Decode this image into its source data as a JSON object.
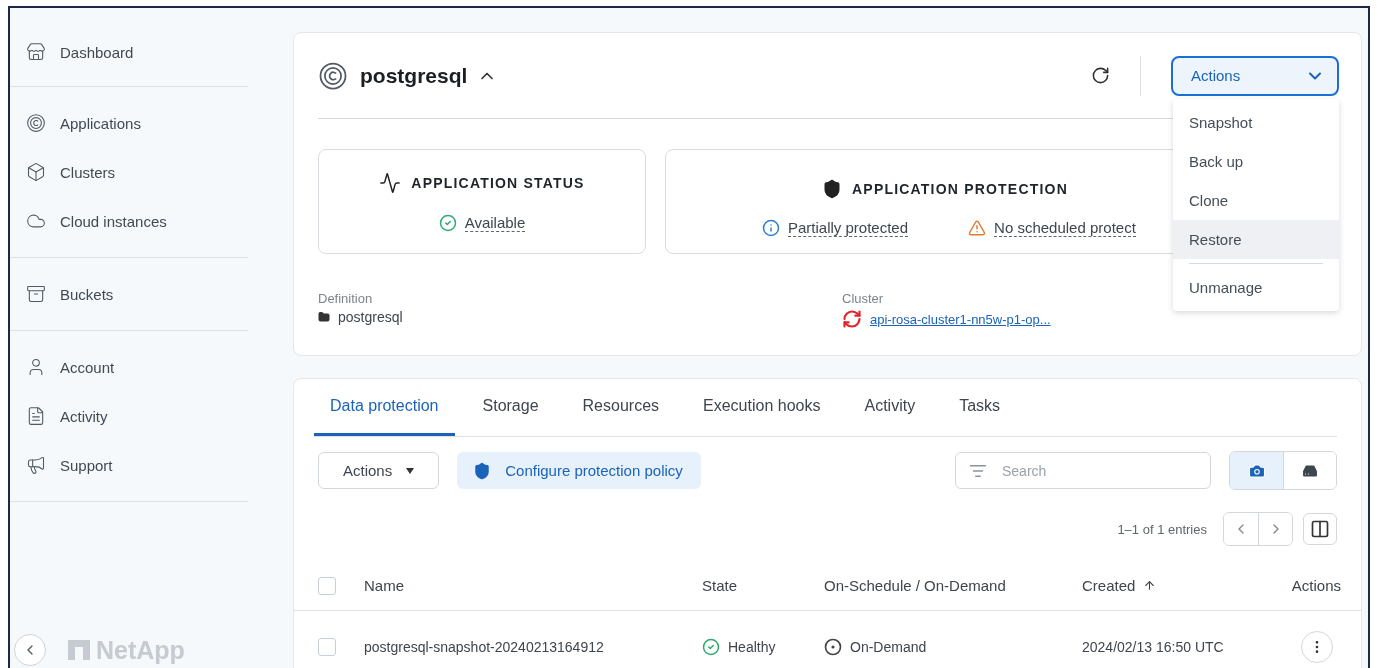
{
  "sidebar": {
    "groups": [
      [
        {
          "label": "Dashboard"
        }
      ],
      [
        {
          "label": "Applications"
        },
        {
          "label": "Clusters"
        },
        {
          "label": "Cloud instances"
        }
      ],
      [
        {
          "label": "Buckets"
        }
      ],
      [
        {
          "label": "Account"
        },
        {
          "label": "Activity"
        },
        {
          "label": "Support"
        }
      ]
    ],
    "brand": "NetApp"
  },
  "app": {
    "name": "postgresql",
    "expanded": true,
    "actions": {
      "label": "Actions",
      "open": true,
      "menu": [
        {
          "label": "Snapshot",
          "highlighted": false,
          "separator_before": false
        },
        {
          "label": "Back up",
          "highlighted": false,
          "separator_before": false
        },
        {
          "label": "Clone",
          "highlighted": false,
          "separator_before": false
        },
        {
          "label": "Restore",
          "highlighted": true,
          "separator_before": false
        },
        {
          "label": "Unmanage",
          "highlighted": false,
          "separator_before": true
        }
      ]
    },
    "status_card": {
      "title": "APPLICATION STATUS",
      "status": "Available"
    },
    "protection_card": {
      "title": "APPLICATION PROTECTION",
      "items": [
        {
          "kind": "info",
          "text": "Partially protected"
        },
        {
          "kind": "warning",
          "text": "No scheduled protect"
        }
      ]
    },
    "definition": {
      "label": "Definition",
      "value": "postgresql"
    },
    "cluster": {
      "label": "Cluster",
      "value": "api-rosa-cluster1-nn5w-p1-op..."
    }
  },
  "tabs": [
    {
      "label": "Data protection",
      "selected": true
    },
    {
      "label": "Storage",
      "selected": false
    },
    {
      "label": "Resources",
      "selected": false
    },
    {
      "label": "Execution hooks",
      "selected": false
    },
    {
      "label": "Activity",
      "selected": false
    },
    {
      "label": "Tasks",
      "selected": false
    }
  ],
  "toolbar": {
    "actions": "Actions",
    "configure": "Configure protection policy",
    "search": {
      "placeholder": "Search"
    },
    "view_toggle": [
      {
        "kind": "snapshots",
        "selected": true
      },
      {
        "kind": "backups",
        "selected": false
      }
    ]
  },
  "pagination": "1–1 of 1 entries",
  "table": {
    "header_checked": false,
    "columns": [
      {
        "label": "Name",
        "sorted": false
      },
      {
        "label": "State",
        "sorted": false
      },
      {
        "label": "On-Schedule / On-Demand",
        "sorted": false
      },
      {
        "label": "Created",
        "sorted": true
      },
      {
        "label": "Actions",
        "sorted": false
      }
    ],
    "rows": [
      {
        "checked": false,
        "name": "postgresql-snapshot-20240213164912",
        "state": "Healthy",
        "trigger": "On-Demand",
        "created": "2024/02/13 16:50 UTC"
      }
    ]
  }
}
